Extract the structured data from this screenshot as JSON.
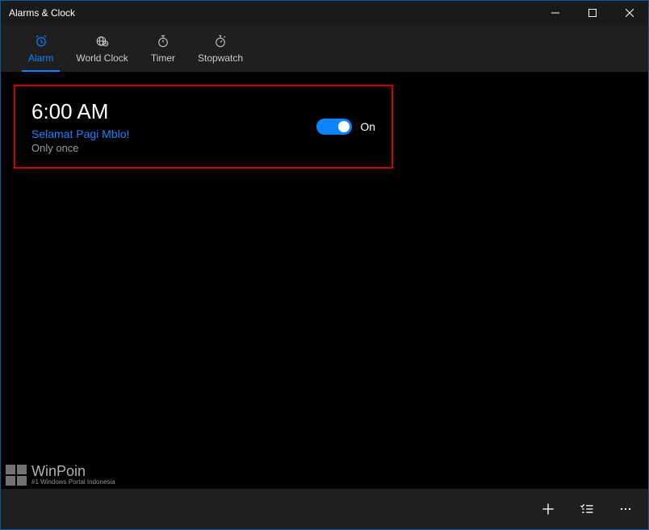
{
  "window": {
    "title": "Alarms & Clock"
  },
  "tabs": [
    {
      "id": "alarm",
      "label": "Alarm",
      "active": true
    },
    {
      "id": "world_clock",
      "label": "World Clock",
      "active": false
    },
    {
      "id": "timer",
      "label": "Timer",
      "active": false
    },
    {
      "id": "stopwatch",
      "label": "Stopwatch",
      "active": false
    }
  ],
  "alarm_item": {
    "time": "6:00 AM",
    "label": "Selamat Pagi Mblo!",
    "repeat": "Only once",
    "toggle_state": "On",
    "highlight_color": "#cc0000"
  },
  "toggle": {
    "on_color": "#0a84ff"
  },
  "watermark": {
    "brand": "WinPoin",
    "tagline": "#1 Windows Portal Indonesia"
  }
}
